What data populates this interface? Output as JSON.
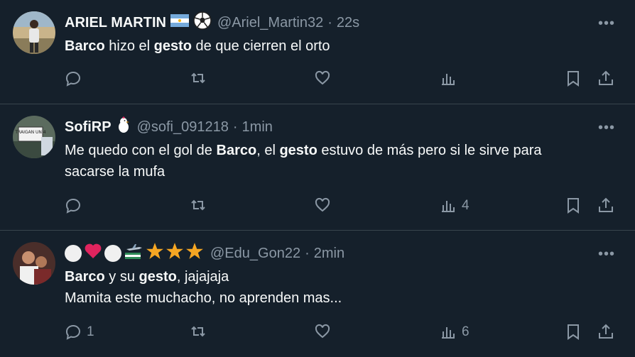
{
  "tweets": [
    {
      "name": "ARIEL MARTIN",
      "handle": "@Ariel_Martin32",
      "time": "22s",
      "lines": [
        [
          {
            "t": "Barco",
            "b": true
          },
          {
            "t": " hizo el "
          },
          {
            "t": "gesto",
            "b": true
          },
          {
            "t": " de que cierren el orto"
          }
        ]
      ],
      "stats": {
        "replies": "",
        "retweets": "",
        "likes": "",
        "views": ""
      }
    },
    {
      "name": "SofiRP",
      "handle": "@sofi_091218",
      "time": "1min",
      "avatar_sign": "TRAIGAN UN 4",
      "lines": [
        [
          {
            "t": "Me quedo con el gol de "
          },
          {
            "t": "Barco",
            "b": true
          },
          {
            "t": ", el "
          },
          {
            "t": "gesto",
            "b": true
          },
          {
            "t": " estuvo de más pero si le sirve para"
          }
        ],
        [
          {
            "t": "sacarse la mufa"
          }
        ]
      ],
      "stats": {
        "replies": "",
        "retweets": "",
        "likes": "",
        "views": "4"
      }
    },
    {
      "name": "",
      "handle": "@Edu_Gon22",
      "time": "2min",
      "lines": [
        [
          {
            "t": "Barco",
            "b": true
          },
          {
            "t": " y su "
          },
          {
            "t": "gesto",
            "b": true
          },
          {
            "t": ", jajajaja"
          }
        ],
        [
          {
            "t": "Mamita este muchacho, no aprenden mas..."
          }
        ]
      ],
      "stats": {
        "replies": "1",
        "retweets": "",
        "likes": "",
        "views": "6"
      }
    }
  ],
  "separator": "·",
  "colors": {
    "background": "#15202b",
    "text": "#f7f9f9",
    "muted": "#8b98a5",
    "border": "#38444d",
    "star": "#f5a623",
    "heart": "#e0245e"
  },
  "icons": [
    "more-icon",
    "reply-icon",
    "retweet-icon",
    "like-icon",
    "views-icon",
    "bookmark-icon",
    "share-icon",
    "argentina-flag-icon",
    "soccer-ball-icon",
    "chicken-icon",
    "white-circle-icon",
    "red-heart-icon",
    "airplane-icon",
    "star-icon"
  ]
}
